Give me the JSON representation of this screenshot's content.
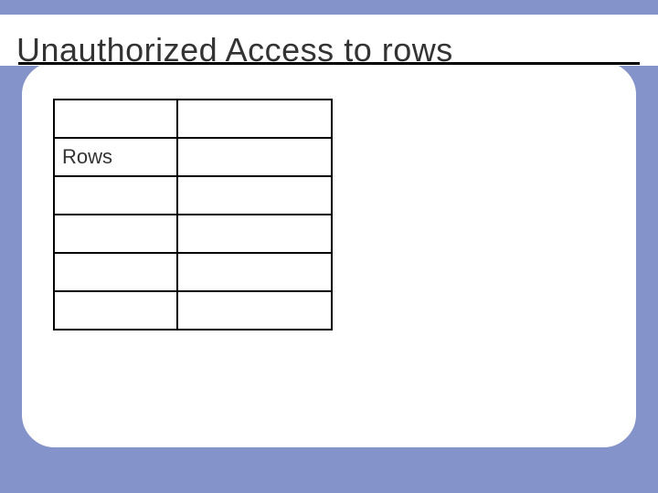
{
  "slide": {
    "title": "Unauthorized Access to rows"
  },
  "table": {
    "rows": [
      {
        "label": "",
        "value": ""
      },
      {
        "label": "Rows",
        "value": ""
      },
      {
        "label": "",
        "value": ""
      },
      {
        "label": "",
        "value": ""
      },
      {
        "label": "",
        "value": ""
      },
      {
        "label": "",
        "value": ""
      }
    ]
  }
}
